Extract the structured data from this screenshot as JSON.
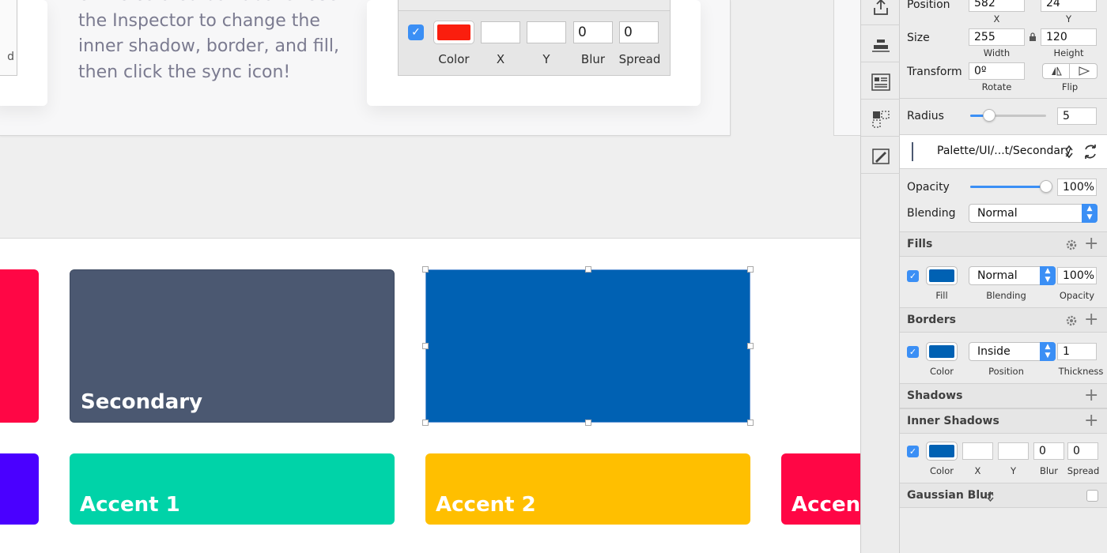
{
  "canvas": {
    "doc_text": "entire colored box above. Use the Inspector to change the inner shadow, border, and fill, then click the sync icon!",
    "card_fragment": "d",
    "mock": {
      "swatch_color": "#fa1e0e",
      "x": "",
      "y": "",
      "blur": "0",
      "spread": "0",
      "labels": {
        "color": "Color",
        "x": "X",
        "y": "Y",
        "blur": "Blur",
        "spread": "Spread"
      }
    },
    "swatches": {
      "secondary": {
        "label": "Secondary",
        "color": "#4b5871"
      },
      "selected": {
        "color": "#0061b3"
      },
      "accent1": {
        "label": "Accent 1",
        "color": "#00d3a8"
      },
      "accent2": {
        "label": "Accent 2",
        "color": "#ffbf00"
      },
      "accent3": {
        "label": "Accent",
        "color": "#ff0645"
      }
    }
  },
  "inspector": {
    "position": {
      "label": "Position",
      "x": "582",
      "y": "24",
      "x_label": "X",
      "y_label": "Y"
    },
    "size": {
      "label": "Size",
      "width": "255",
      "height": "120",
      "width_label": "Width",
      "height_label": "Height"
    },
    "transform": {
      "label": "Transform",
      "rotate": "0º",
      "rotate_label": "Rotate",
      "flip_label": "Flip"
    },
    "radius": {
      "label": "Radius",
      "value": "5",
      "slider_fraction": 0.25
    },
    "shared_style": "Palette/UI/...t/Secondary",
    "opacity": {
      "label": "Opacity",
      "value": "100%",
      "slider_fraction": 1.0
    },
    "blending": {
      "label": "Blending",
      "value": "Normal"
    },
    "fills": {
      "title": "Fills",
      "color": "#0061b3",
      "blending": "Normal",
      "opacity": "100%",
      "labels": {
        "fill": "Fill",
        "blending": "Blending",
        "opacity": "Opacity"
      }
    },
    "borders": {
      "title": "Borders",
      "color": "#0061b3",
      "position": "Inside",
      "thickness": "1",
      "labels": {
        "color": "Color",
        "position": "Position",
        "thickness": "Thickness"
      }
    },
    "shadows": {
      "title": "Shadows"
    },
    "inner_shadows": {
      "title": "Inner Shadows",
      "color": "#0061b3",
      "x": "",
      "y": "",
      "blur": "0",
      "spread": "0",
      "labels": {
        "color": "Color",
        "x": "X",
        "y": "Y",
        "blur": "Blur",
        "spread": "Spread"
      }
    },
    "gaussian_blur": {
      "title": "Gaussian Blur"
    }
  },
  "toolbar": {
    "icons": [
      "export-icon",
      "align-icon",
      "layout-icon",
      "symbol-icon",
      "edit-image-icon"
    ]
  }
}
